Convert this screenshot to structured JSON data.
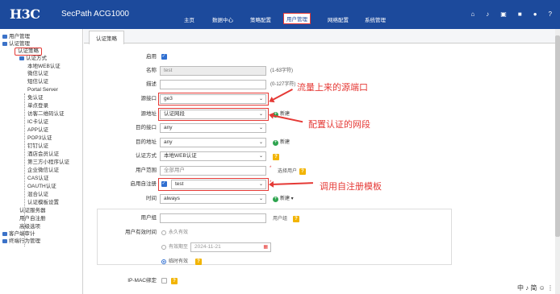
{
  "header": {
    "logo": "H3C",
    "product": "SecPath ACG1000",
    "nav": [
      "主页",
      "数据中心",
      "策略配置",
      "用户管理",
      "网络配置",
      "系统管理"
    ],
    "icons": [
      "home-icon",
      "bell-icon",
      "save-icon",
      "lock-icon",
      "user-icon",
      "help-icon"
    ]
  },
  "sidebar": {
    "items": [
      "用户管理",
      "认证管理",
      "认证策略",
      "认证方式",
      "本地WEB认证",
      "微信认证",
      "短信认证",
      "Portal Server",
      "免认证",
      "单点登录",
      "访客二维码认证",
      "IC卡认证",
      "APP认证",
      "POP3认证",
      "钉钉认证",
      "酒店会员认证",
      "第三方小程序认证",
      "企业微信认证",
      "CAS认证",
      "OAUTH认证",
      "混合认证",
      "认证模板设置",
      "认证服务器",
      "用户自注册",
      "高级选项",
      "客户端审计",
      "终端行为管理"
    ]
  },
  "tab": "认证策略",
  "form": {
    "enable_label": "启用",
    "name_label": "名称",
    "name_value": "test",
    "name_hint": "(1-63字符)",
    "desc_label": "描述",
    "desc_hint": "(0-127字符)",
    "src_if_label": "源接口",
    "src_if_value": "ge3",
    "src_addr_label": "源地址",
    "src_addr_value": "认证网段",
    "dst_if_label": "目的接口",
    "dst_if_value": "any",
    "dst_addr_label": "目的地址",
    "dst_addr_value": "any",
    "auth_method_label": "认证方式",
    "auth_method_value": "本地WEB认证",
    "user_scope_label": "用户范围",
    "user_scope_placeholder": "全部用户",
    "user_scope_hint": "选择用户",
    "selfreg_label": "启用自注册",
    "selfreg_value": "test",
    "time_label": "时间",
    "time_value": "always",
    "new_label": "新建",
    "user_group_label": "用户组",
    "user_group_hint": "用户组",
    "validity_label": "用户有效时间",
    "opt_forever": "永久有效",
    "opt_until": "有效期至",
    "date_placeholder": "2024-11-21",
    "opt_temp": "临时有效",
    "ipmac_label": "IP-MAC绑定"
  },
  "annotations": {
    "a1": "流量上来的源端口",
    "a2": "配置认证的网段",
    "a3": "调用自注册模板"
  },
  "ime": "中 ♪ 简 ☺ ⋮"
}
